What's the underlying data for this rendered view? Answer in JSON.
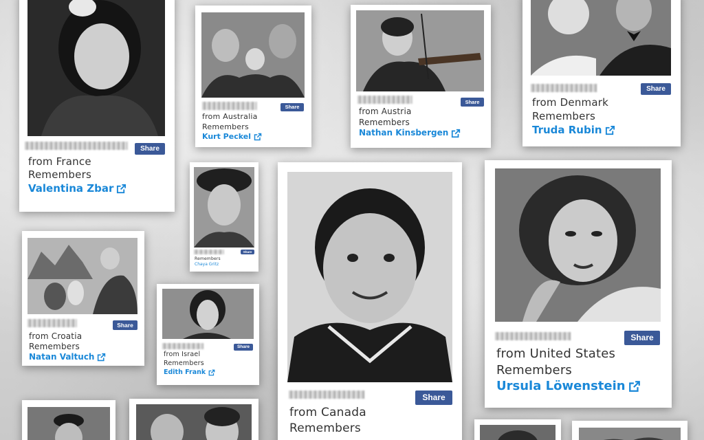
{
  "share_label": "Share",
  "cards": {
    "valentina": {
      "country": "from France",
      "remembers": "Remembers",
      "name": "Valentina Zbar"
    },
    "kurt": {
      "country": "from Australia",
      "remembers": "Remembers",
      "name": "Kurt Peckel"
    },
    "nathan": {
      "country": "from Austria",
      "remembers": "Remembers",
      "name": "Nathan Kinsbergen"
    },
    "truda": {
      "country": "from Denmark",
      "remembers": "Remembers",
      "name": "Truda Rubin"
    },
    "chaya": {
      "remembers": "Remembers",
      "name": "Chaya Gritz"
    },
    "natan": {
      "country": "from Croatia",
      "remembers": "Remembers",
      "name": "Natan Valtuch"
    },
    "edith": {
      "country": "from Israel",
      "remembers": "Remembers",
      "name": "Edith Frank"
    },
    "canada": {
      "country": "from Canada",
      "remembers": "Remembers"
    },
    "ursula": {
      "country": "from United States",
      "remembers": "Remembers",
      "name": "Ursula Löwenstein"
    }
  }
}
